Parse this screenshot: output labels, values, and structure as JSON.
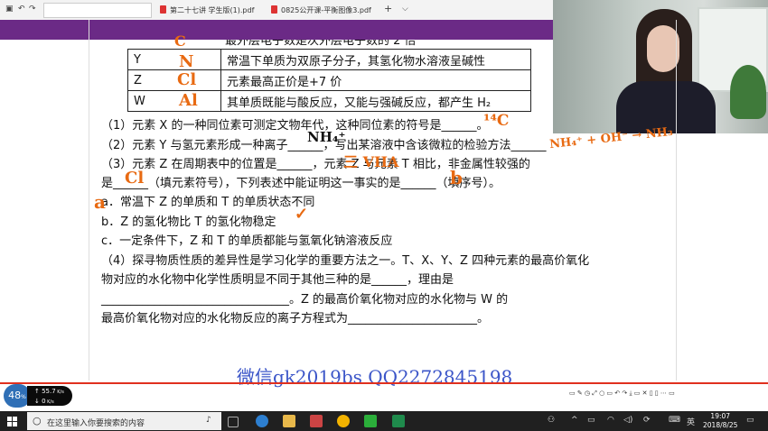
{
  "browser": {
    "tabs": [
      {
        "label": "第二十七讲 学生版(1).pdf"
      },
      {
        "label": "0825公开课-平衡图像3.pdf"
      }
    ],
    "new_tab": "+",
    "dropdown": "⌵"
  },
  "table": {
    "rows": [
      {
        "key": "Y",
        "value": "常温下单质为双原子分子，其氢化物水溶液呈碱性"
      },
      {
        "key": "Z",
        "value": "元素最高正价是+7 价"
      },
      {
        "key": "W",
        "value": "其单质既能与酸反应，又能与强碱反应，都产生 H₂"
      }
    ],
    "partial_top_row": "最外层电子数是次外层电子数的 2 倍"
  },
  "questions": {
    "q1": "（1）元素 X 的一种同位素可测定文物年代，这种同位素的符号是______。",
    "q2": "（2）元素 Y 与氢元素形成一种离子______，写出某溶液中含该微粒的检验方法______",
    "q3a": "（3）元素 Z 在周期表中的位置是______，元素 Z 与元素 T 相比，非金属性较强的",
    "q3b": "是______（填元素符号），下列表述中能证明这一事实的是______（填序号）。",
    "opt_a": "a．常温下 Z 的单质和 T 的单质状态不同",
    "opt_b": "b．Z 的氢化物比 T 的氢化物稳定",
    "opt_c": "c．一定条件下，Z 和 T 的单质都能与氢氧化钠溶液反应",
    "q4a": "（4）探寻物质性质的差异性是学习化学的重要方法之一。T、X、Y、Z 四种元素的最高价氧化",
    "q4b": "物对应的水化物中化学性质明显不同于其他三种的是______，理由是",
    "q4c": "________________________________。Z 的最高价氧化物对应的水化物与 W 的",
    "q4d": "最高价氧化物对应的水化物反应的离子方程式为______________________。"
  },
  "annotations": {
    "c": "C",
    "n": "N",
    "cl": "Cl",
    "al": "Al",
    "c14": "¹⁴C",
    "nh4": "NH₄⁺",
    "period": "三 VIIA",
    "cl2": "Cl",
    "b": "b",
    "a_mark": "a",
    "check": "✓",
    "right_note": "NH₄⁺ + OH⁻ → NH₃"
  },
  "watermark": "微信gk2019bs QQ2272845198",
  "speed_meter": {
    "percent": "48",
    "up": "55.7",
    "down": "0"
  },
  "taskbar": {
    "search_placeholder": "在这里输入你要搜索的内容",
    "ime": "英",
    "time": "19:07",
    "date": "2018/8/25"
  },
  "colors": {
    "ink": "#e86a12",
    "watermark": "#3b55c8",
    "purple_bar": "#6b2a86"
  }
}
